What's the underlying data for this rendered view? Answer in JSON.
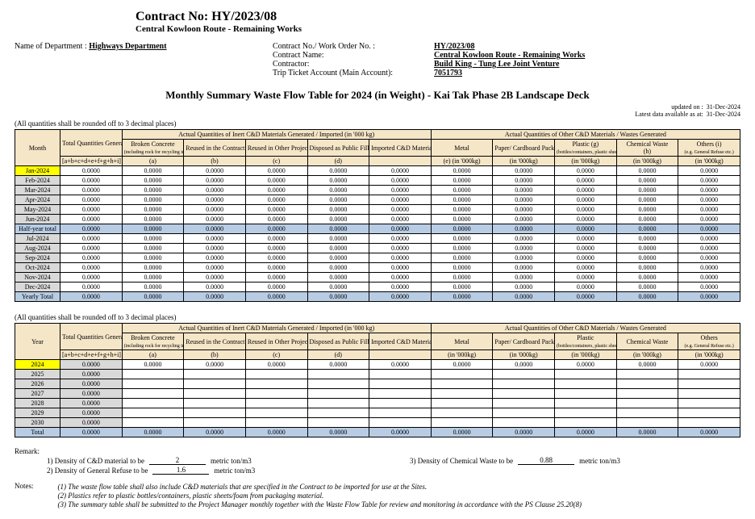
{
  "header": {
    "contract_no_label": "Contract No: HY/2023/08",
    "project": "Central Kowloon Route - Remaining Works",
    "dept_label": "Name of Department :",
    "dept": "Highways Department",
    "cnwo_label": "Contract No./ Work Order No. :",
    "cnwo": "HY/2023/08",
    "cname_label": "Contract Name:",
    "cname": "Central Kowloon Route - Remaining Works",
    "contractor_label": "Contractor:",
    "contractor": "Build King - Tung Lee Joint Venture",
    "trip_label": "Trip Ticket Account (Main Account):",
    "trip": "7051793"
  },
  "title": "Monthly Summary Waste Flow Table for 2024 (in Weight) - Kai Tak Phase 2B Landscape Deck",
  "updated": {
    "l1": "updated on :",
    "v1": "31-Dec-2024",
    "l2": "Latest data available as at:",
    "v2": "31-Dec-2024"
  },
  "round_note": "(All quantities shall be rounded off to 3 decimal places)",
  "group_inert": "Actual Quantities of Inert C&D Materials Generated / Imported (in '000 kg)",
  "group_other": "Actual Quantities of Other C&D Materials / Wastes Generated",
  "cols": {
    "month": "Month",
    "year": "Year",
    "total": "Total Quantities Generated",
    "total_sub": "[a+b+c+d+e+f+g+h+i]",
    "a": "Broken Concrete",
    "a_sub": "(including rock for recycling into aggregates)",
    "a_ltr": "(a)",
    "b": "Reused in the Contract",
    "b_ltr": "(b)",
    "c": "Reused in Other Projects",
    "c_ltr": "(c)",
    "d": "Disposed as Public Fill",
    "d_ltr": "(d)",
    "e": "Imported C&D Material",
    "metal": "Metal",
    "metal_ltr": "(e)  (in '000kg)",
    "paper": "Paper/ Cardboard Packaging  (f)",
    "paper_ltr": "(in '000kg)",
    "plastic": "Plastic  (g)",
    "plastic_sub": "(bottles/containers, plastic sheets/ foams from package",
    "plastic_ltr": "(in '000kg)",
    "chem": "Chemical Waste",
    "chem_ltr": "(h)",
    "chem_ltr2": "(in '000kg)",
    "other": "Others (i)",
    "other_sub": "(e.g. General Refuse etc.)",
    "other_ltr": "(in '000kg)",
    "other2": "Others",
    "total2": "Total"
  },
  "rows": [
    {
      "m": "Jan-2024",
      "hl": "yellow"
    },
    {
      "m": "Feb-2024"
    },
    {
      "m": "Mar-2024"
    },
    {
      "m": "Apr-2024"
    },
    {
      "m": "May-2024"
    },
    {
      "m": "Jun-2024"
    },
    {
      "m": "Half-year total",
      "hl": "blue"
    },
    {
      "m": "Jul-2024"
    },
    {
      "m": "Aug-2024"
    },
    {
      "m": "Sep-2024"
    },
    {
      "m": "Oct-2024"
    },
    {
      "m": "Nov-2024"
    },
    {
      "m": "Dec-2024"
    },
    {
      "m": "Yearly Total",
      "hl": "blue"
    }
  ],
  "val": "0.0000",
  "yrows": [
    {
      "y": "2024",
      "hl": "yellow",
      "fill": true
    },
    {
      "y": "2025"
    },
    {
      "y": "2026"
    },
    {
      "y": "2027"
    },
    {
      "y": "2028"
    },
    {
      "y": "2029"
    },
    {
      "y": "2030"
    },
    {
      "y": "Total",
      "hl": "blue",
      "fill": true
    }
  ],
  "remark": {
    "title": "Remark:",
    "d1_label": "1) Density of C&D material to be",
    "d1": "2",
    "unit": "metric ton/m3",
    "d2_label": "2) Density of General Refuse to be",
    "d2": "1.6",
    "d3_label": "3) Density of Chemical Waste to be",
    "d3": "0.88"
  },
  "notes": {
    "title": "Notes:",
    "items": [
      "(1)  The waste flow table shall also include C&D materials that are specified in the Contract to be imported for use at the Sites.",
      "(2)  Plastics refer to plastic bottles/containers, plastic sheets/foam from packaging material.",
      "(3)  The summary table shall be submitted to the Project Manager monthly together with the Waste Flow Table for review and monitoring in accordance with the PS Clause 25.20(8)"
    ]
  }
}
